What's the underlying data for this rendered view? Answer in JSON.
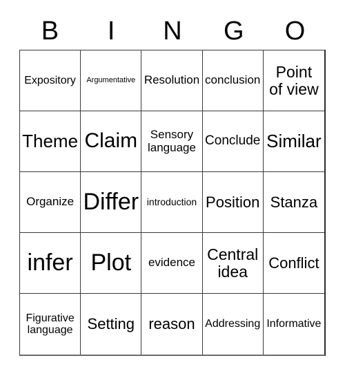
{
  "card": {
    "title": "BINGO",
    "header_letters": [
      "B",
      "I",
      "N",
      "G",
      "O"
    ],
    "grid_size": "5x5",
    "border_color": "#3a3a3a",
    "background_color": "#ffffff",
    "text_color": "#000000",
    "cells": [
      {
        "text": "Expository",
        "size": "md"
      },
      {
        "text": "Argumentative",
        "size": "xs"
      },
      {
        "text": "Resolution",
        "size": "ml"
      },
      {
        "text": "conclusion",
        "size": "ml"
      },
      {
        "text": "Point\nof view",
        "size": "xxl"
      },
      {
        "text": "Theme",
        "size": "h1"
      },
      {
        "text": "Claim",
        "size": "h2"
      },
      {
        "text": "Sensory\nlanguage",
        "size": "ml"
      },
      {
        "text": "Conclude",
        "size": "lg"
      },
      {
        "text": "Similar",
        "size": "h1"
      },
      {
        "text": "Organize",
        "size": "ml"
      },
      {
        "text": "Differ",
        "size": "h3"
      },
      {
        "text": "introduction",
        "size": "sm"
      },
      {
        "text": "Position",
        "size": "xl"
      },
      {
        "text": "Stanza",
        "size": "xl"
      },
      {
        "text": "infer",
        "size": "h3"
      },
      {
        "text": "Plot",
        "size": "h3"
      },
      {
        "text": "evidence",
        "size": "ml"
      },
      {
        "text": "Central\nidea",
        "size": "xxl"
      },
      {
        "text": "Conflict",
        "size": "xl"
      },
      {
        "text": "Figurative\nlanguage",
        "size": "md"
      },
      {
        "text": "Setting",
        "size": "xl"
      },
      {
        "text": "reason",
        "size": "xl"
      },
      {
        "text": "Addressing",
        "size": "md"
      },
      {
        "text": "Informative",
        "size": "md"
      }
    ]
  }
}
